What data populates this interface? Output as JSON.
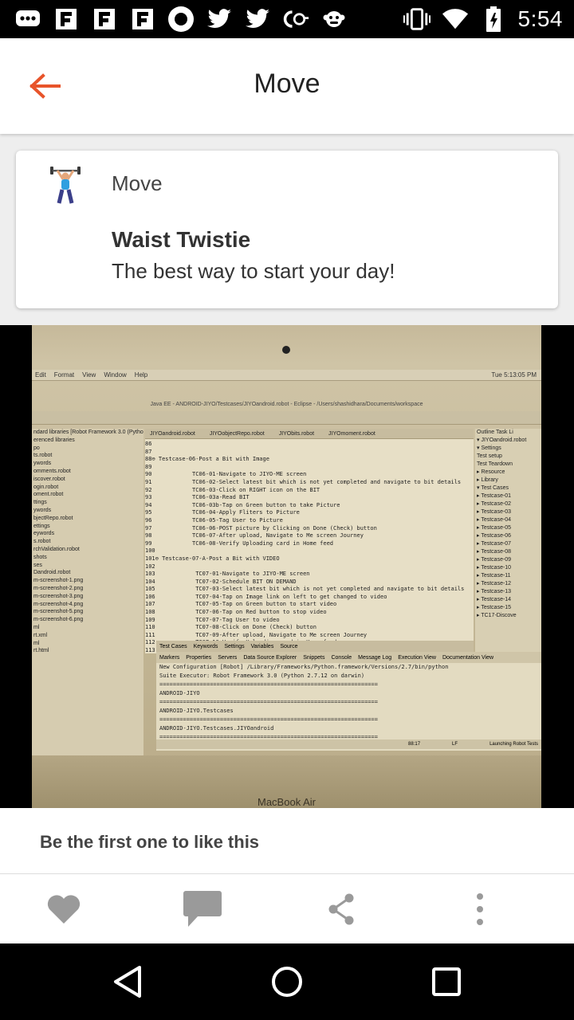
{
  "status_bar": {
    "time": "5:54",
    "left_icons": [
      "message-icon",
      "flipboard-icon",
      "flipboard-icon",
      "flipboard-icon",
      "record-icon",
      "twitter-icon",
      "twitter-icon",
      "cc-icon",
      "monkey-icon"
    ],
    "right_icons": [
      "vibrate-icon",
      "wifi-icon",
      "battery-icon"
    ]
  },
  "app_bar": {
    "title": "Move",
    "back_color": "#e8542a"
  },
  "card": {
    "category": "Move",
    "title": "Waist Twistie",
    "subtitle": "The best way to start your day!"
  },
  "photo": {
    "menubar": [
      "Edit",
      "Format",
      "View",
      "Window",
      "Help"
    ],
    "menubar_right": "Tue 5:13:05 PM",
    "window_title": "Java EE - ANDROID-JIYO/Testcases/JIYOandroid.robot - Eclipse - /Users/shashidhara/Documents/workspace",
    "sidebar_lines": [
      "ndard libraries [Robot Framework 3.0 (Python",
      "erenced libraries",
      "",
      "",
      "po",
      "ts.robot",
      "ywords",
      "omments.robot",
      "iscover.robot",
      "ogin.robot",
      "oment.robot",
      "ttings",
      "ywords",
      "bjectRepo.robot",
      "ettings",
      "eywords",
      "s.robot",
      "rchValidation.robot",
      "shots",
      "ses",
      "Dandroid.robot",
      "m-screenshot-1.png",
      "m-screenshot-2.png",
      "m-screenshot-3.png",
      "m-screenshot-4.png",
      "m-screenshot-5.png",
      "m-screenshot-6.png",
      "ml",
      "rt.xml",
      "ml",
      "rt.html"
    ],
    "editor_tabs": [
      "JIYOandroid.robot",
      "JIYOobjectRepo.robot",
      "JIYObits.robot",
      "JIYOmoment.robot"
    ],
    "editor_lines": [
      "86",
      "87",
      "88⊖ Testcase-06-Post a Bit with Image",
      "89",
      "90            TC06-01-Navigate to JIYO-ME screen",
      "91            TC06-02-Select latest bit which is not yet completed and navigate to bit details",
      "92            TC06-03-Click on RIGHT icon on the BIT",
      "93            TC06-03a-Read BIT",
      "94            TC06-03b-Tap on Green button to take Picture",
      "95            TC06-04-Apply Fliters to Picture",
      "96            TC06-05-Tag User to Picture",
      "97            TC06-06-POST picture by Clicking on Done (Check) button",
      "98            TC06-07-After upload, Navigate to Me screen Journey",
      "99            TC06-08-Verify Uploading card in Home feed",
      "100",
      "101⊖ Testcase-07-A-Post a Bit with VIDEO",
      "102",
      "103            TC07-01-Navigate to JIYO-ME screen",
      "104            TC07-02-Schedule BIT ON DEMAND",
      "105            TC07-03-Select latest bit which is not yet completed and navigate to bit details",
      "106            TC07-04-Tap on Image link on left to get changed to video",
      "107            TC07-05-Tap on Green button to start video",
      "108            TC07-06-Tap on Red button to stop video",
      "109            TC07-07-Tag User to video",
      "110            TC07-08-Click on Done (Check) button",
      "111            TC07-09-After upload, Navigate to Me screen Journey",
      "112            TC07-10-Verify Uploading card in Home feed",
      "113"
    ],
    "outline_lines": [
      "Outline  Task Li",
      "▾ JIYOandroid.robot",
      "  ▾ Settings",
      "     Test setup",
      "     Test Teardown",
      "   ▸ Resource",
      "   ▸ Library",
      "  ▾ Test Cases",
      "   ▸ Testcase-01",
      "   ▸ Testcase-02",
      "   ▸ Testcase-03",
      "   ▸ Testcase-04",
      "   ▸ Testcase-05",
      "   ▸ Testcase-06",
      "   ▸ Testcase-07",
      "   ▸ Testcase-08",
      "   ▸ Testcase-09",
      "   ▸ Testcase-10",
      "   ▸ Testcase-11",
      "   ▸ Testcase-12",
      "   ▸ Testcase-13",
      "   ▸ Testcase-14",
      "   ▸ Testcase-15",
      "   ▸ TC17-Discove"
    ],
    "bottom_tabs": [
      "Test Cases",
      "Keywords",
      "Settings",
      "Variables",
      "Source"
    ],
    "console_tabs": [
      "Markers",
      "Properties",
      "Servers",
      "Data Source Explorer",
      "Snippets",
      "Console",
      "Message Log",
      "Execution View",
      "Documentation View"
    ],
    "console_lines": [
      "New Configuration [Robot] /Library/Frameworks/Python.framework/Versions/2.7/bin/python",
      "Suite Executor: Robot Framework 3.0 (Python 2.7.12 on darwin)",
      "=================================================================",
      "ANDROID-JIYO",
      "=================================================================",
      "ANDROID-JIYO.Testcases",
      "=================================================================",
      "ANDROID-JIYO.Testcases.JIYOandroid",
      "=================================================================",
      "Testcase-06-Post a Bit with Image"
    ],
    "status_line": [
      "88:17",
      "LF",
      "Launching Robot Tests"
    ],
    "laptop_label": "MacBook Air"
  },
  "likes": {
    "text": "Be the first one to like this"
  },
  "actions": [
    "heart-icon",
    "comment-icon",
    "share-icon",
    "more-vert-icon"
  ],
  "nav": [
    "back-triangle-icon",
    "home-circle-icon",
    "recents-square-icon"
  ]
}
